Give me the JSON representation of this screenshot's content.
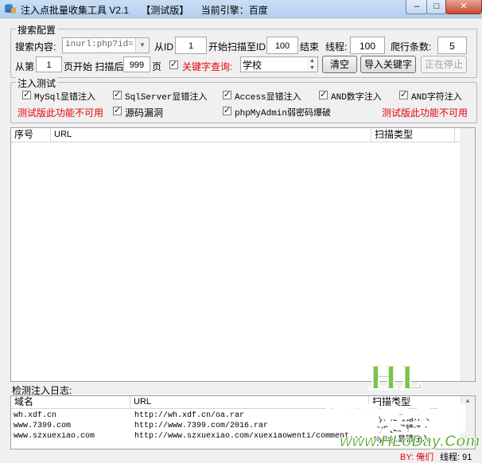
{
  "window": {
    "title": "注入点批量收集工具 V2.1",
    "edition": "【测试版】",
    "engine_label": "当前引擎：百度",
    "min_label": "–",
    "max_label": "□",
    "close_label": "✕"
  },
  "search_config": {
    "legend": "搜索配置",
    "content_label": "搜索内容:",
    "content_value": "inurl:php?id=",
    "from_id_label": "从ID",
    "from_id_value": "1",
    "scan_to_label": "开始扫描至ID",
    "scan_to_value": "100",
    "end_label": "结束",
    "threads_label": "线程:",
    "threads_value": "100",
    "crawl_label": "爬行条数:",
    "crawl_value": "5",
    "from_page_label": "从第",
    "from_page_value": "1",
    "page_start_label": "页开始 扫描后",
    "page_after_value": "999",
    "page_label": "页",
    "keyword_label": "关键字查询:",
    "keyword_value": "学校",
    "clear_button": "清空",
    "import_button": "导入关键字",
    "stop_button": "正在停止"
  },
  "inject_test": {
    "legend": "注入测试",
    "options": [
      {
        "label": "MySql显错注入"
      },
      {
        "label": "SqlServer显错注入"
      },
      {
        "label": "Access显错注入"
      },
      {
        "label": "AND数字注入"
      },
      {
        "label": "AND字符注入"
      },
      {
        "label": "源码漏洞"
      },
      {
        "label": "phpMyAdmin弱密码爆破"
      }
    ],
    "unavailable_left": "测试版此功能不可用",
    "unavailable_right": "测试版此功能不可用"
  },
  "results_table": {
    "columns": [
      "序号",
      "URL",
      "扫描类型"
    ]
  },
  "log": {
    "legend": "检测注入日志:",
    "columns": [
      "域名",
      "URL",
      "扫描类型"
    ],
    "rows": [
      {
        "domain": "wh.xdf.cn",
        "url": "http://wh.xdf.cn/oa.rar",
        "type": "MySQL显错注入"
      },
      {
        "domain": "www.7399.com",
        "url": "http://www.7399.com/2016.rar",
        "type": "MySQL显错注入"
      },
      {
        "domain": "www.szxuexiao.com",
        "url": "http://www.szxuexiao.com/xuexiaowenti/comment...",
        "type": "MySQL显错注入"
      }
    ]
  },
  "status": {
    "author": "BY: 俺们",
    "threads": "线程: 91"
  },
  "watermark": {
    "hl": "HL",
    "name": "红盟安全网",
    "url": "www.HLoDay.Com"
  },
  "colors": {
    "warning_red": "#e8000b",
    "watermark_green": "#76b640"
  }
}
